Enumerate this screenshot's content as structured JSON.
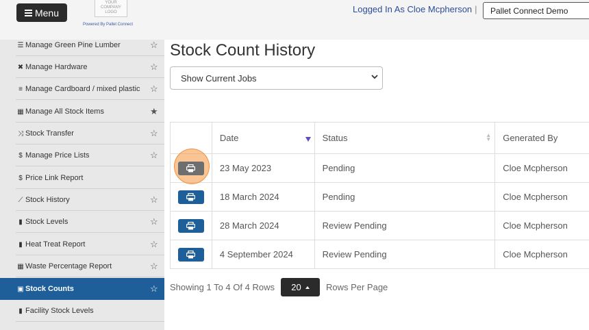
{
  "header": {
    "menu_label": "Menu",
    "logo_text": "YOUR COMPANY LOGO",
    "powered_by": "Powered By Pallet Connect",
    "logged_in": "Logged In As Cloe Mcpherson",
    "separator": "|",
    "company_selected": "Pallet Connect Demo"
  },
  "sidebar": {
    "items": [
      {
        "label": "Manage Green Pine Lumber",
        "icon": "list-icon",
        "starred": false,
        "active": false
      },
      {
        "label": "Manage Hardware",
        "icon": "tools-icon",
        "starred": false,
        "active": false
      },
      {
        "label": "Manage Cardboard / mixed plastic",
        "icon": "lines-icon",
        "starred": false,
        "active": false
      },
      {
        "label": "Manage All Stock Items",
        "icon": "warehouse-icon",
        "starred": true,
        "active": false
      },
      {
        "label": "Stock Transfer",
        "icon": "shuffle-icon",
        "starred": false,
        "active": false
      },
      {
        "label": "Manage Price Lists",
        "icon": "dollar-icon",
        "starred": false,
        "active": false
      },
      {
        "label": "Price Link Report",
        "icon": "dollar-icon",
        "starred": null,
        "active": false
      },
      {
        "label": "Stock History",
        "icon": "chart-line-icon",
        "starred": false,
        "active": false
      },
      {
        "label": "Stock Levels",
        "icon": "file-icon",
        "starred": false,
        "active": false
      },
      {
        "label": "Heat Treat Report",
        "icon": "file-icon",
        "starred": false,
        "active": false
      },
      {
        "label": "Waste Percentage Report",
        "icon": "table-icon",
        "starred": false,
        "active": false
      },
      {
        "label": "Stock Counts",
        "icon": "boxes-icon",
        "starred": false,
        "active": true
      },
      {
        "label": "Facility Stock Levels",
        "icon": "file-icon",
        "starred": null,
        "active": false
      }
    ]
  },
  "main": {
    "title": "Stock Count History",
    "job_filter": "Show Current Jobs",
    "table": {
      "headers": [
        "",
        "Date",
        "Status",
        "Generated By"
      ],
      "rows": [
        {
          "date": "23 May 2023",
          "status": "Pending",
          "generated_by": "Cloe Mcpherson"
        },
        {
          "date": "18 March 2024",
          "status": "Pending",
          "generated_by": "Cloe Mcpherson"
        },
        {
          "date": "28 March 2024",
          "status": "Review Pending",
          "generated_by": "Cloe Mcpherson"
        },
        {
          "date": "4 September 2024",
          "status": "Review Pending",
          "generated_by": "Cloe Mcpherson"
        }
      ]
    },
    "pager": {
      "showing": "Showing 1 To 4 Of 4 Rows",
      "page_size": "20",
      "rows_per_page": "Rows Per Page"
    }
  },
  "colors": {
    "accent": "#1e5f9a",
    "highlight": "#f5963c",
    "dark_button": "#2b2b2b"
  }
}
